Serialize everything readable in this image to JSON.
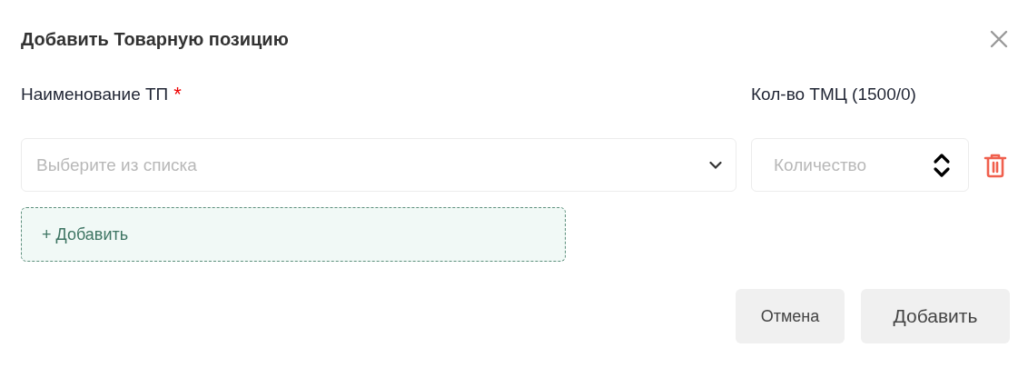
{
  "dialog": {
    "title": "Добавить Товарную позицию"
  },
  "fields": {
    "name_label": "Наименование ТП",
    "name_required": true,
    "required_mark": "*",
    "quantity_label": "Кол-во ТМЦ (1500/0)"
  },
  "rows": [
    {
      "name_placeholder": "Выберите из списка",
      "quantity_placeholder": "Количество"
    }
  ],
  "add_row_button": "+ Добавить",
  "buttons": [
    {
      "label": "Отмена",
      "kind": "secondary"
    },
    {
      "label": "Добавить",
      "kind": "primary"
    }
  ]
}
